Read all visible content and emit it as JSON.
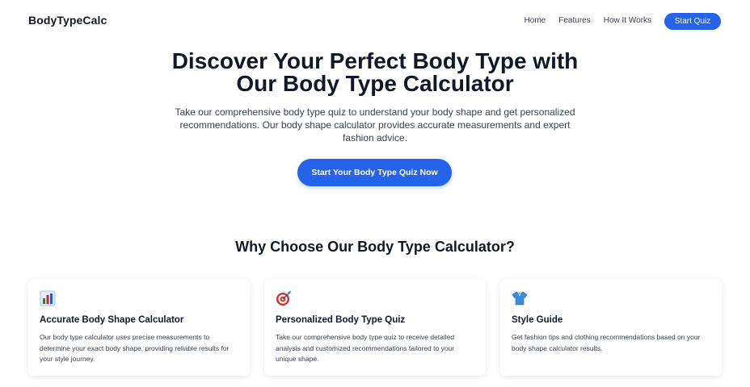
{
  "nav": {
    "brand": "BodyTypeCalc",
    "links": [
      "Home",
      "Features",
      "How It Works"
    ],
    "cta": "Start Quiz"
  },
  "hero": {
    "title_line1": "Discover Your Perfect Body Type with",
    "title_line2": "Our Body Type Calculator",
    "subtitle": "Take our comprehensive body type quiz to understand your body shape and get personalized recommendations. Our body shape calculator provides accurate measurements and expert fashion advice.",
    "cta": "Start Your Body Type Quiz Now"
  },
  "features": {
    "title": "Why Choose Our Body Type Calculator?",
    "cards": [
      {
        "icon": "bar-chart-icon",
        "title": "Accurate Body Shape Calculator",
        "text": "Our body type calculator uses precise measurements to determine your exact body shape, providing reliable results for your style journey."
      },
      {
        "icon": "target-icon",
        "title": "Personalized Body Type Quiz",
        "text": "Take our comprehensive body type quiz to receive detailed analysis and customized recommendations tailored to your unique shape."
      },
      {
        "icon": "shirt-icon",
        "title": "Style Guide",
        "text": "Get fashion tips and clothing recommendations based on your body shape calculator results."
      }
    ]
  },
  "colors": {
    "accent": "#2563eb",
    "text": "#111827",
    "muted": "#374151"
  }
}
